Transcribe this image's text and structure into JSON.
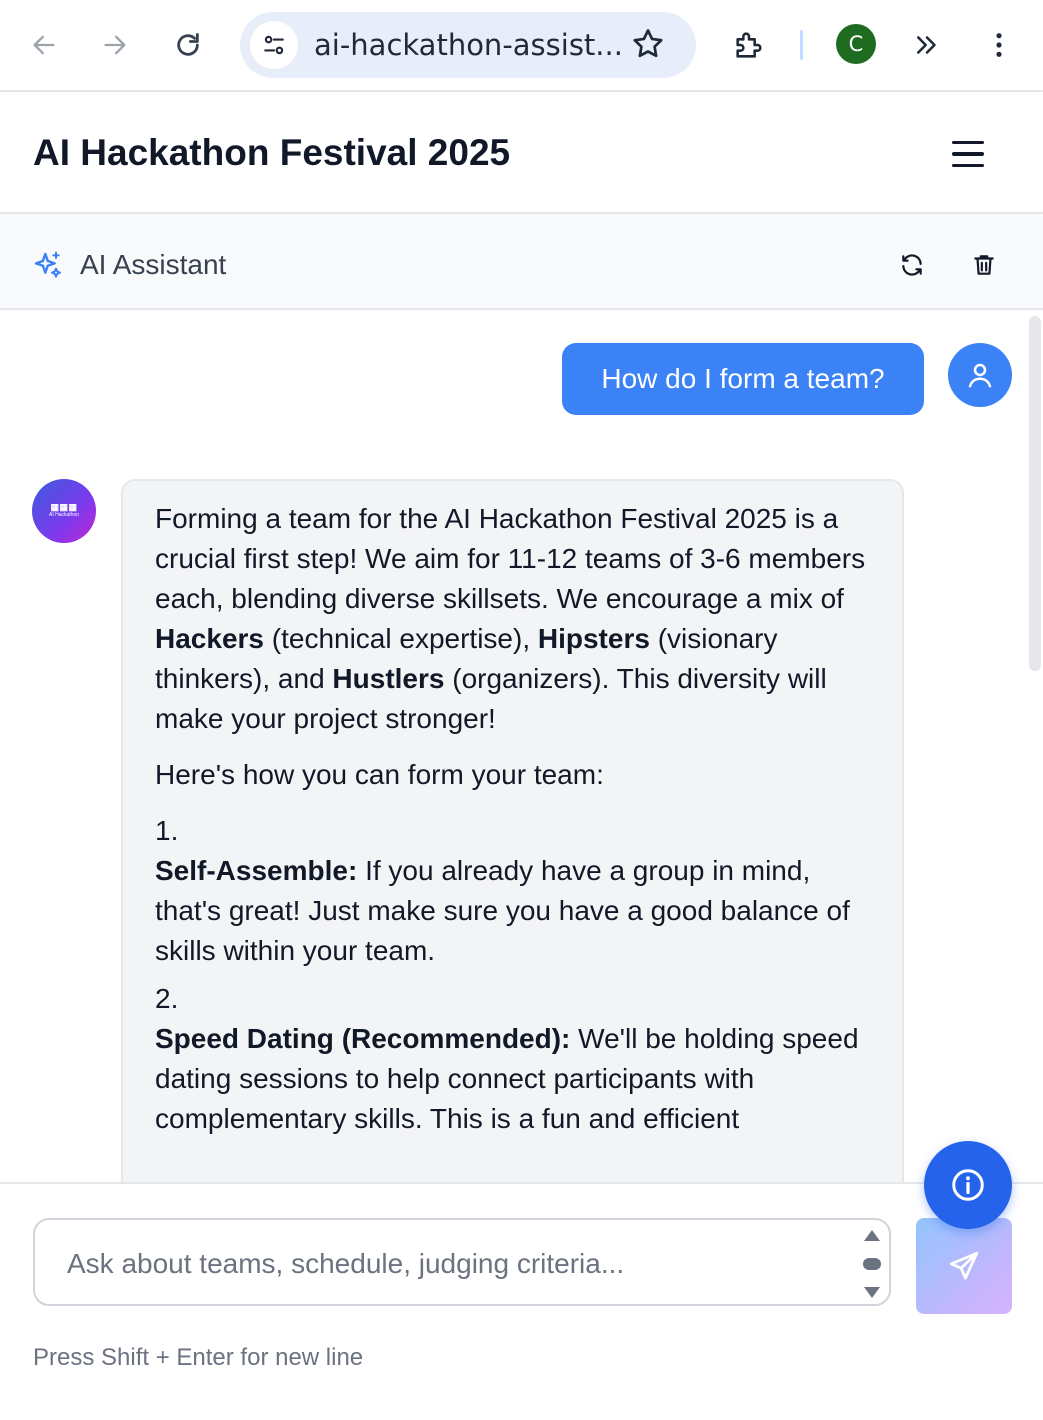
{
  "browser": {
    "url": "ai-hackathon-assist...",
    "profile_initial": "C"
  },
  "app": {
    "title": "AI Hackathon Festival 2025"
  },
  "assistant": {
    "title": "AI Assistant"
  },
  "messages": {
    "user_1": "How do I form a team?",
    "bot_avatar_logo": "AI Hackathon",
    "bot_1": {
      "intro_a": "Forming a team for the AI Hackathon Festival 2025 is a crucial first step! We aim for 11-12 teams of 3-6 members each, blending diverse skillsets. We encourage a mix of ",
      "hackers": "Hackers",
      "intro_b": " (technical expertise), ",
      "hipsters": "Hipsters",
      "intro_c": " (visionary thinkers), and ",
      "hustlers": "Hustlers",
      "intro_d": " (organizers). This diversity will make your project stronger!",
      "howto": "Here's how you can form your team:",
      "items": [
        {
          "num": "1.",
          "title": "Self-Assemble:",
          "text": " If you already have a group in mind, that's great! Just make sure you have a good balance of skills within your team."
        },
        {
          "num": "2.",
          "title": "Speed Dating (Recommended):",
          "text": " We'll be holding speed dating sessions to help connect participants with complementary skills. This is a fun and efficient"
        }
      ]
    }
  },
  "input": {
    "placeholder": "Ask about teams, schedule, judging criteria...",
    "hint": "Press Shift + Enter for new line"
  }
}
